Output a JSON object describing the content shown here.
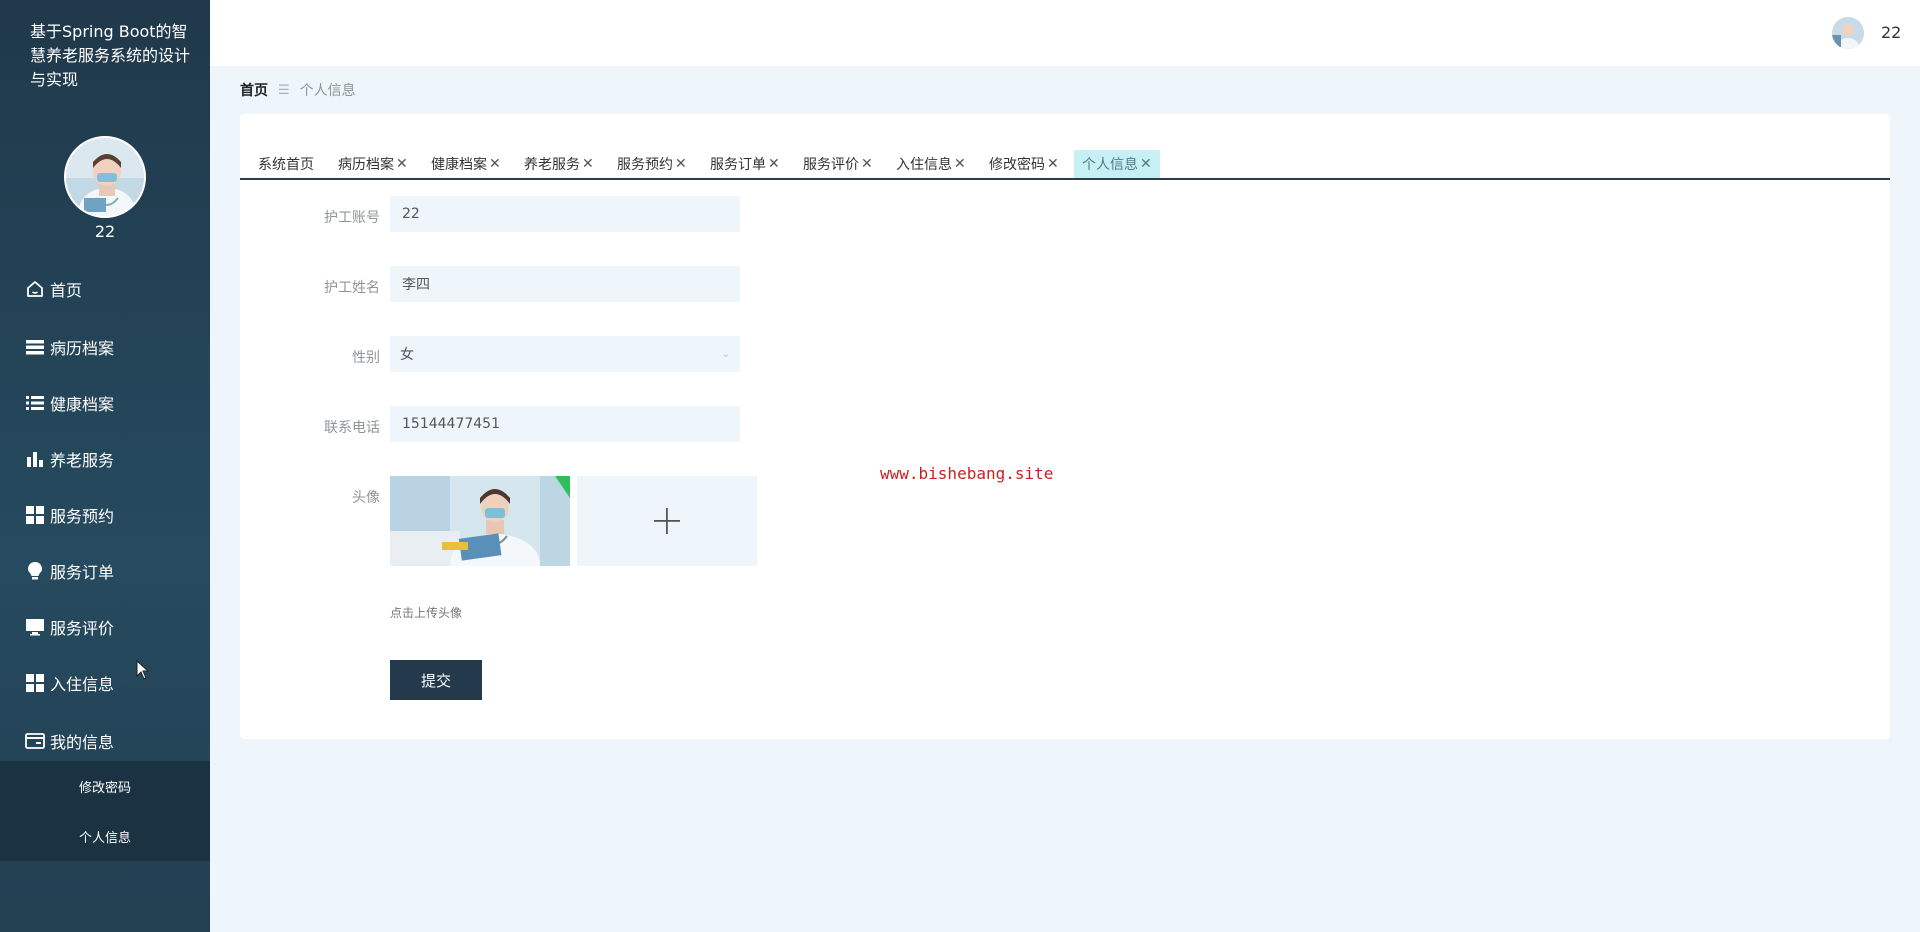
{
  "app": {
    "title": "基于Spring Boot的智慧养老服务系统的设计与实现"
  },
  "sidebar": {
    "username": "22",
    "menu": [
      {
        "label": "首页",
        "icon": "home-icon"
      },
      {
        "label": "病历档案",
        "icon": "list-icon"
      },
      {
        "label": "健康档案",
        "icon": "list-alt-icon"
      },
      {
        "label": "养老服务",
        "icon": "bar-chart-icon"
      },
      {
        "label": "服务预约",
        "icon": "grid-icon"
      },
      {
        "label": "服务订单",
        "icon": "lightbulb-icon"
      },
      {
        "label": "服务评价",
        "icon": "monitor-icon"
      },
      {
        "label": "入住信息",
        "icon": "grid-icon"
      },
      {
        "label": "我的信息",
        "icon": "id-card-icon"
      }
    ],
    "submenu": [
      {
        "label": "修改密码"
      },
      {
        "label": "个人信息"
      }
    ]
  },
  "header": {
    "username": "22"
  },
  "breadcrumb": {
    "home": "首页",
    "separator": "☰",
    "current": "个人信息"
  },
  "tabs": [
    {
      "label": "系统首页",
      "closable": false,
      "active": false
    },
    {
      "label": "病历档案",
      "closable": true,
      "active": false
    },
    {
      "label": "健康档案",
      "closable": true,
      "active": false
    },
    {
      "label": "养老服务",
      "closable": true,
      "active": false
    },
    {
      "label": "服务预约",
      "closable": true,
      "active": false
    },
    {
      "label": "服务订单",
      "closable": true,
      "active": false
    },
    {
      "label": "服务评价",
      "closable": true,
      "active": false
    },
    {
      "label": "入住信息",
      "closable": true,
      "active": false
    },
    {
      "label": "修改密码",
      "closable": true,
      "active": false
    },
    {
      "label": "个人信息",
      "closable": true,
      "active": true
    }
  ],
  "tab_close_glyph": "✕",
  "form": {
    "account_label": "护工账号",
    "account_value": "22",
    "name_label": "护工姓名",
    "name_value": "李四",
    "gender_label": "性别",
    "gender_value": "女",
    "gender_chevron": "⌄",
    "phone_label": "联系电话",
    "phone_value": "15144477451",
    "avatar_label": "头像",
    "upload_hint": "点击上传头像",
    "submit_label": "提交"
  },
  "watermark": "www.bishebang.site",
  "colors": {
    "sidebar_bg": "#20394b",
    "submenu_bg": "#1b3243",
    "page_bg": "#eef6fb",
    "active_tab_bg": "#c6f0f4",
    "submit_bg": "#24394c",
    "watermark": "#cc1f1f"
  }
}
